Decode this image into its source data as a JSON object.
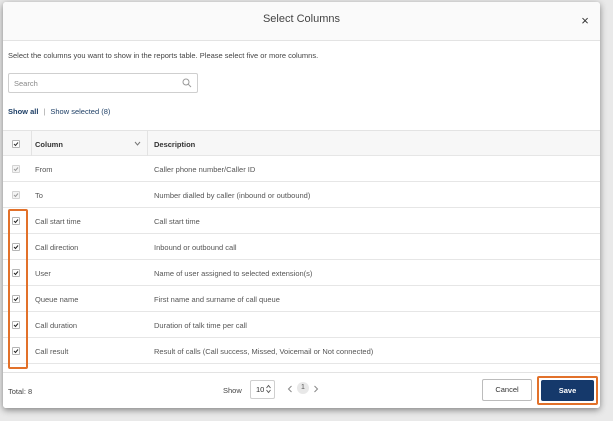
{
  "dialog": {
    "title": "Select Columns",
    "close_glyph": "×",
    "instructions": "Select the columns you want to show in the reports table. Please select five or more columns."
  },
  "search": {
    "placeholder": "Search",
    "value": ""
  },
  "filters": {
    "show_all": "Show all",
    "separator": "|",
    "show_selected": "Show selected (8)"
  },
  "table": {
    "headers": {
      "column": "Column",
      "description": "Description"
    },
    "rows": [
      {
        "column": "From",
        "description": "Caller phone number/Caller ID",
        "checked": true,
        "disabled": true
      },
      {
        "column": "To",
        "description": "Number dialled by caller (inbound or outbound)",
        "checked": true,
        "disabled": true
      },
      {
        "column": "Call start time",
        "description": "Call start time",
        "checked": true,
        "disabled": false
      },
      {
        "column": "Call direction",
        "description": "Inbound or outbound call",
        "checked": true,
        "disabled": false
      },
      {
        "column": "User",
        "description": "Name of user assigned to selected extension(s)",
        "checked": true,
        "disabled": false
      },
      {
        "column": "Queue name",
        "description": "First name and surname of call queue",
        "checked": true,
        "disabled": false
      },
      {
        "column": "Call duration",
        "description": "Duration of talk time per call",
        "checked": true,
        "disabled": false
      },
      {
        "column": "Call result",
        "description": "Result of calls (Call success, Missed, Voicemail or Not connected)",
        "checked": true,
        "disabled": false
      }
    ]
  },
  "footer": {
    "total": "Total: 8",
    "show_label": "Show",
    "page_size": "10",
    "page": "1",
    "cancel_label": "Cancel",
    "save_label": "Save"
  },
  "colors": {
    "highlight": "#e2712a",
    "primary": "#15396b",
    "link": "#1e3f66"
  },
  "icons": [
    "close-icon",
    "search-icon",
    "checkbox-icon",
    "sort-chevron-icon",
    "page-size-arrows-icon",
    "prev-page-icon",
    "next-page-icon"
  ]
}
